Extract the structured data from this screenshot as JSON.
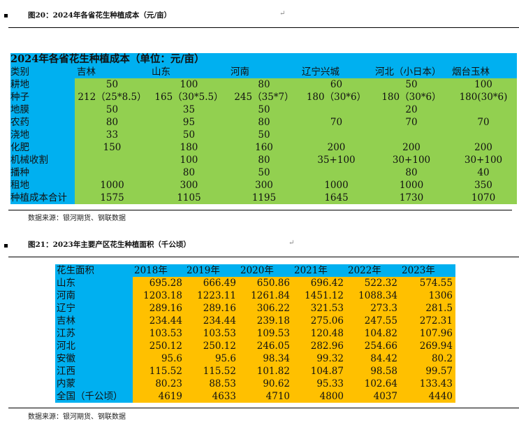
{
  "fig1": {
    "caption": "图20：2024年各省花生种植成本（元/亩）",
    "title": "2024年各省花生种植成本（单位：元/亩）",
    "headers": [
      "类别",
      "吉林",
      "山东",
      "河南",
      "辽宁兴城",
      "河北（小日本）",
      "烟台玉林"
    ],
    "rows": [
      [
        "耕地",
        "50",
        "100",
        "80",
        "60",
        "50",
        "100"
      ],
      [
        "种子",
        "212（25*8.5）",
        "165（30*5.5）",
        "245（35*7）",
        "180（30*6）",
        "180（30*6）",
        "180(30*6)"
      ],
      [
        "地膜",
        "50",
        "35",
        "50",
        "",
        "20",
        ""
      ],
      [
        "农药",
        "80",
        "95",
        "80",
        "70",
        "70",
        "70"
      ],
      [
        "浇地",
        "33",
        "50",
        "50",
        "",
        "",
        ""
      ],
      [
        "化肥",
        "150",
        "180",
        "160",
        "200",
        "200",
        "200"
      ],
      [
        "机械收割",
        "",
        "100",
        "80",
        "35+100",
        "30+100",
        "30+100"
      ],
      [
        "播种",
        "",
        "80",
        "50",
        "",
        "80",
        "40"
      ],
      [
        "租地",
        "1000",
        "300",
        "300",
        "1000",
        "1000",
        "350"
      ],
      [
        "种植成本合计",
        "1575",
        "1105",
        "1195",
        "1645",
        "1730",
        "1070"
      ]
    ],
    "source": "数据来源：银河期货、钢联数据"
  },
  "fig2": {
    "caption": "图21：2023年主要产区花生种植面积（千公顷）",
    "headers": [
      "花生面积",
      "2018年",
      "2019年",
      "2020年",
      "2021年",
      "2022年",
      "2023年"
    ],
    "rows": [
      [
        "山东",
        "695.28",
        "666.49",
        "650.86",
        "696.42",
        "522.32",
        "574.55"
      ],
      [
        "河南",
        "1203.18",
        "1223.11",
        "1261.84",
        "1451.12",
        "1088.34",
        "1306"
      ],
      [
        "辽宁",
        "289.16",
        "289.16",
        "306.22",
        "321.53",
        "273.3",
        "281.5"
      ],
      [
        "吉林",
        "234.44",
        "234.44",
        "239.18",
        "275.06",
        "247.55",
        "272.31"
      ],
      [
        "江苏",
        "103.53",
        "103.53",
        "109.53",
        "120.48",
        "104.82",
        "107.96"
      ],
      [
        "河北",
        "250.12",
        "250.12",
        "246.05",
        "282.96",
        "254.66",
        "269.94"
      ],
      [
        "安徽",
        "95.6",
        "95.6",
        "98.34",
        "99.32",
        "84.42",
        "80.2"
      ],
      [
        "江西",
        "115.52",
        "115.52",
        "101.82",
        "104.87",
        "98.58",
        "99.57"
      ],
      [
        "内蒙",
        "80.23",
        "88.53",
        "90.62",
        "95.33",
        "102.64",
        "133.43"
      ],
      [
        "全国（千公顷）",
        "4619",
        "4633",
        "4710",
        "4800",
        "4037",
        "4440"
      ]
    ],
    "source": "数据来源：银河期货、钢联数据"
  },
  "return_mark": "↵",
  "colors": {
    "blue": "#00B0F0",
    "green": "#92D050",
    "orange": "#FFC000"
  }
}
